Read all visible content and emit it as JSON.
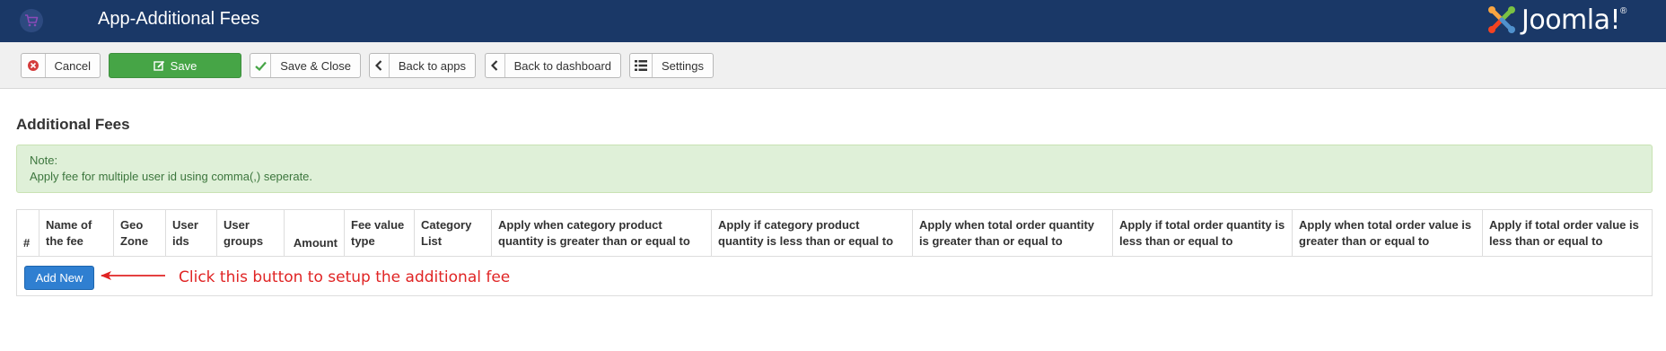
{
  "header": {
    "title": "App-Additional Fees",
    "app_icon": "cart-icon",
    "brand": {
      "name": "Joomla!",
      "mark": "®"
    }
  },
  "toolbar": {
    "cancel": "Cancel",
    "save": "Save",
    "save_close": "Save & Close",
    "back_apps": "Back to apps",
    "back_dashboard": "Back to dashboard",
    "settings": "Settings"
  },
  "main": {
    "section_title": "Additional Fees",
    "note": {
      "title": "Note:",
      "text": "Apply fee for multiple user id using comma(,) seperate."
    },
    "table": {
      "columns": [
        "#",
        "Name of the fee",
        "Geo Zone",
        "User ids",
        "User groups",
        "Amount",
        "Fee value type",
        "Category List",
        "Apply when category product quantity is greater than or equal to",
        "Apply if category product quantity is less than or equal to",
        "Apply when total order quantity is greater than or equal to",
        "Apply if total order quantity is less than or equal to",
        "Apply when total order value is greater than or equal to",
        "Apply if total order value is less than or equal to"
      ]
    },
    "add_button": "Add New",
    "callout": "Click this button to setup the additional fee"
  },
  "colors": {
    "header_bg": "#1a3867",
    "save_green": "#46a546",
    "primary_blue": "#2f7fd1",
    "note_bg": "#dff0d8",
    "callout_red": "#e02424"
  }
}
